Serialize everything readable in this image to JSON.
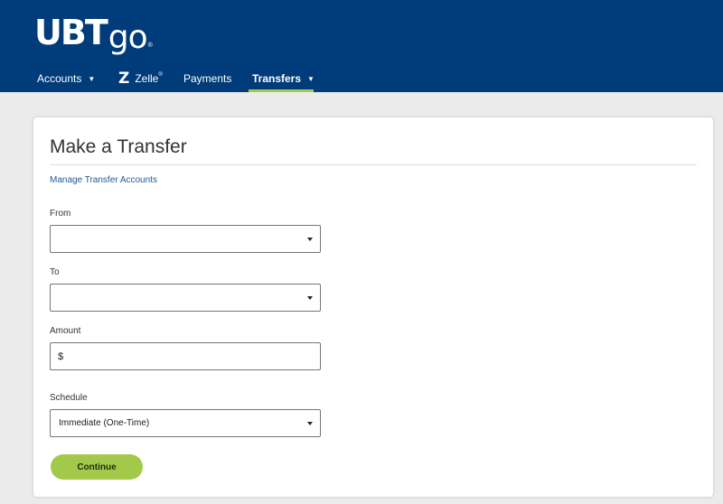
{
  "header": {
    "logo_ubt": "UBT",
    "logo_go": "go",
    "logo_tm": "®",
    "brand_color": "#003b7a"
  },
  "nav": {
    "accounts": "Accounts",
    "zelle_mark": "Z",
    "zelle": "Zelle",
    "zelle_reg": "®",
    "payments": "Payments",
    "transfers": "Transfers",
    "active_color": "#a3c94a"
  },
  "form": {
    "title": "Make a Transfer",
    "manage_link": "Manage Transfer Accounts",
    "from_label": "From",
    "from_value": "",
    "to_label": "To",
    "to_value": "",
    "amount_label": "Amount",
    "amount_prefix": "$",
    "amount_value": "",
    "schedule_label": "Schedule",
    "schedule_value": "Immediate (One-Time)",
    "continue_label": "Continue"
  }
}
